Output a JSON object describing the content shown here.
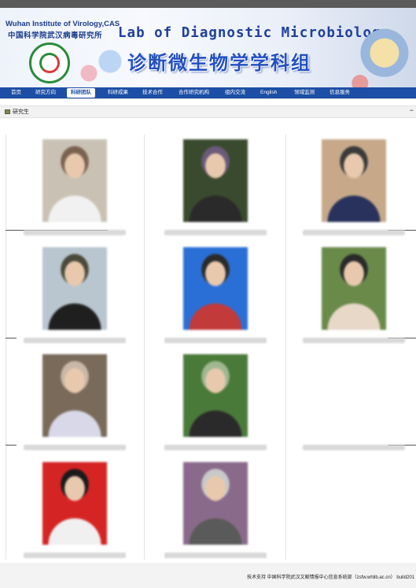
{
  "header": {
    "institute_en": "Wuhan Institute of Virology,CAS",
    "institute_cn": "中国科学院武汉病毒研究所",
    "lab_en": "Lab of Diagnostic Microbiology",
    "lab_cn": "诊断微生物学学科组"
  },
  "nav": {
    "items": [
      {
        "label": "首页"
      },
      {
        "label": "研究方向"
      },
      {
        "label": "科研团队"
      },
      {
        "label": "科研成果"
      },
      {
        "label": "技术合作"
      },
      {
        "label": "合作研究机构"
      },
      {
        "label": "组内交流"
      },
      {
        "label": "English"
      },
      {
        "label": "领域监测"
      },
      {
        "label": "信息服务"
      }
    ],
    "active_index": 2
  },
  "panel": {
    "title": "研究生",
    "collapse_symbol": "−"
  },
  "people": [
    {
      "photo_colors": [
        "#c9c2b4",
        "#7a6250",
        "#f1f1f1"
      ]
    },
    {
      "photo_colors": [
        "#3a4a2e",
        "#6b5a7a",
        "#2a2a2a"
      ]
    },
    {
      "photo_colors": [
        "#c7a98a",
        "#3a3a3a",
        "#28325c"
      ]
    },
    {
      "photo_colors": [
        "#b9c6cf",
        "#4a4a3a",
        "#1f1f1f"
      ]
    },
    {
      "photo_colors": [
        "#2a6fd6",
        "#2a2a2a",
        "#c23a3a"
      ]
    },
    {
      "photo_colors": [
        "#6a8a4a",
        "#2a2a2a",
        "#e8d8c8"
      ]
    },
    {
      "photo_colors": [
        "#7a6a5a",
        "#c9b8a8",
        "#d8d8e8"
      ]
    },
    {
      "photo_colors": [
        "#4a7a3a",
        "#a0b890",
        "#2a2a2a"
      ]
    },
    {
      "photo_colors": [
        "#d42424",
        "#1a1a1a",
        "#f0f0f0"
      ]
    },
    {
      "photo_colors": [
        "#8a6a8a",
        "#c9c9c9",
        "#5a5a5a"
      ]
    }
  ],
  "footer": {
    "text": "技术支持 中国科学院武汉文献情报中心信息系统部（zsfw.whlib.ac.cn） build201"
  },
  "colors": {
    "nav_bg": "#1c4fa5",
    "title_blue": "#1f3f9a"
  }
}
